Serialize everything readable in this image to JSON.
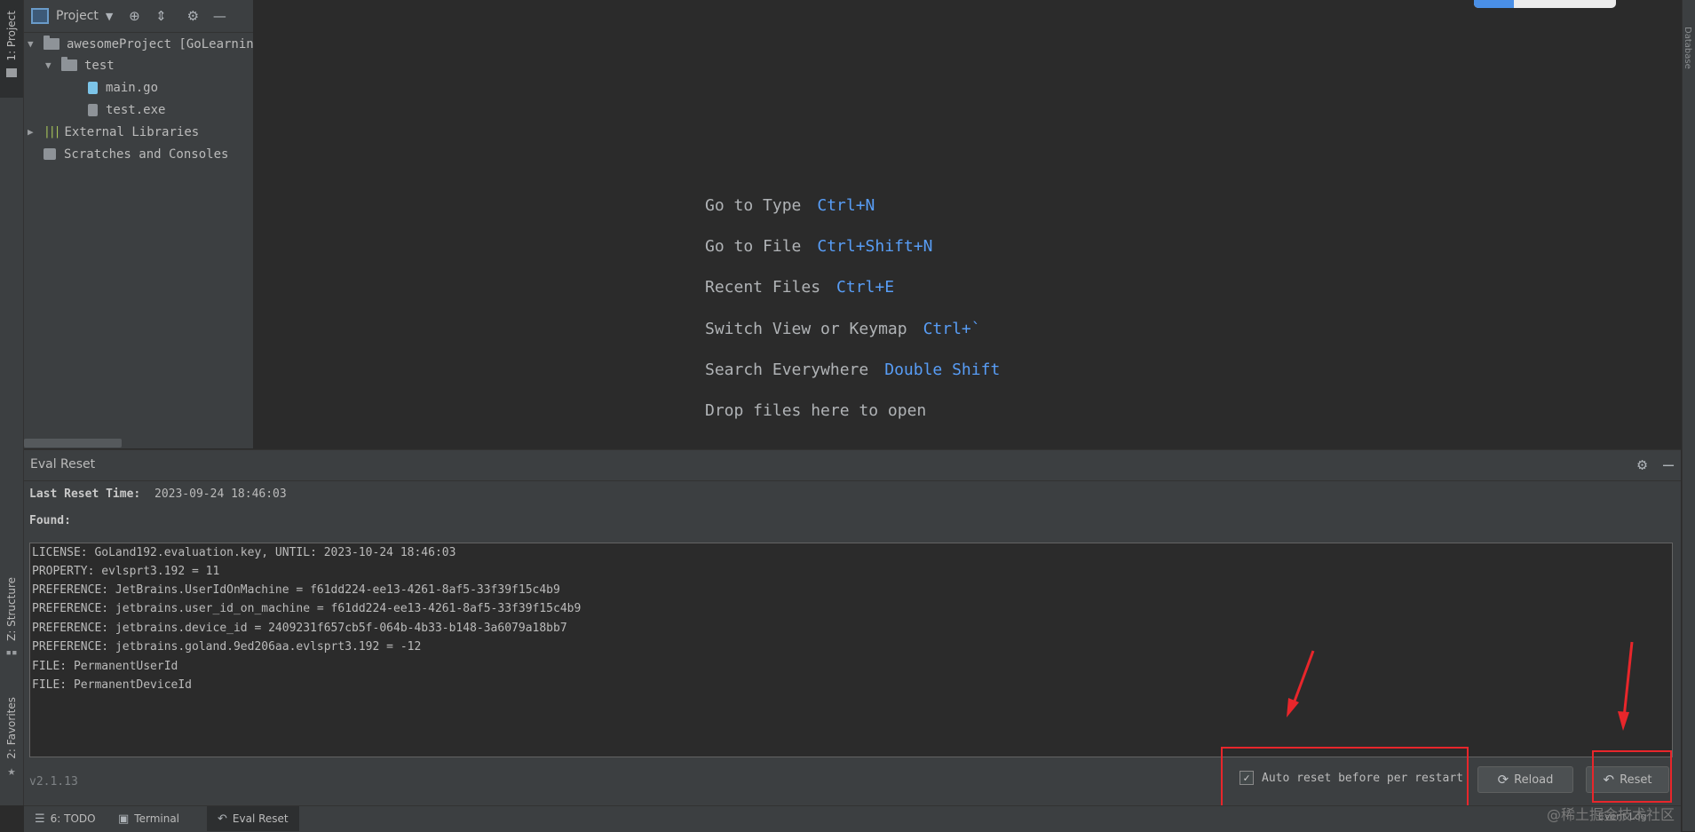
{
  "left_strip": {
    "project_tab": "1: Project",
    "structure_tab": "Z: Structure",
    "favorites_tab": "2: Favorites"
  },
  "right_strip": {
    "database_tab": "Database"
  },
  "project_panel": {
    "title": "Project",
    "tree": [
      {
        "label": "awesomeProject [GoLearning]",
        "icon": "folder-icon"
      },
      {
        "label": "test",
        "icon": "folder-icon"
      },
      {
        "label": "main.go",
        "icon": "go-file-icon"
      },
      {
        "label": "test.exe",
        "icon": "unknown-file-icon"
      },
      {
        "label": "External Libraries",
        "icon": "library-icon"
      },
      {
        "label": "Scratches and Consoles",
        "icon": "scratches-icon"
      }
    ]
  },
  "editor": {
    "hints": [
      {
        "text": "Go to Type",
        "shortcut": "Ctrl+N"
      },
      {
        "text": "Go to File",
        "shortcut": "Ctrl+Shift+N"
      },
      {
        "text": "Recent Files",
        "shortcut": "Ctrl+E"
      },
      {
        "text": "Switch View or Keymap",
        "shortcut": "Ctrl+`"
      },
      {
        "text": "Search Everywhere",
        "shortcut": "Double Shift"
      },
      {
        "text": "Drop files here to open",
        "shortcut": ""
      }
    ]
  },
  "eval_reset": {
    "title": "Eval Reset",
    "last_reset_label": "Last Reset Time:",
    "last_reset_value": "2023-09-24 18:46:03",
    "found_label": "Found:",
    "found_lines": [
      "LICENSE: GoLand192.evaluation.key, UNTIL: 2023-10-24 18:46:03",
      "PROPERTY: evlsprt3.192 = 11",
      "PREFERENCE: JetBrains.UserIdOnMachine = f61dd224-ee13-4261-8af5-33f39f15c4b9",
      "PREFERENCE: jetbrains.user_id_on_machine = f61dd224-ee13-4261-8af5-33f39f15c4b9",
      "PREFERENCE: jetbrains.device_id = 2409231f657cb5f-064b-4b33-b148-3a6079a18bb7",
      "PREFERENCE: jetbrains.goland.9ed206aa.evlsprt3.192 = -12",
      "FILE: PermanentUserId",
      "FILE: PermanentDeviceId"
    ],
    "version": "v2.1.13",
    "auto_reset_label": "Auto reset before per restart",
    "auto_reset_checked": true,
    "reload_label": "Reload",
    "reset_label": "Reset"
  },
  "status_bar": {
    "todo": "6: TODO",
    "terminal": "Terminal",
    "eval_reset": "Eval Reset",
    "event_log": "Event Log",
    "watermark": "@稀土掘金技术社区"
  },
  "colors": {
    "annotation": "#e8262b",
    "shortcut": "#589df6"
  }
}
